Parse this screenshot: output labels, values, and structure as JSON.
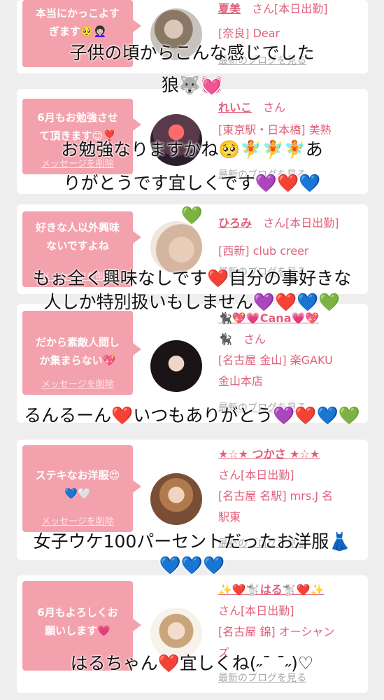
{
  "colors": {
    "pink": "#f3a2ad",
    "name": "#e0607a",
    "bg": "#eeeeee"
  },
  "cards": [
    {
      "message": "本当にかっこよす\nぎます🥺👩🏻‍🦱",
      "delete": "メッセージを削除",
      "name": "夏美",
      "san": "さん",
      "status": "[本日出勤]",
      "area": "[奈良] Dear",
      "blog": "最新のブログを見る"
    },
    {
      "message": "6月もお勉強させ\nて頂きます😊❣️",
      "delete": "メッセージを削除",
      "name": "れいこ",
      "san": "さん",
      "status": "",
      "area": "[東京駅・日本橋] 美熟",
      "blog": "最新のブログを見る"
    },
    {
      "message": "好きな人以外興味\nないですよね",
      "delete": "メッセージを削除",
      "name": "ひろみ",
      "san": "さん",
      "status": "[本日出勤]",
      "area": "[西新] club creer",
      "blog": "最新のブログを見る"
    },
    {
      "message": "だから素敵人間し\nか集まらない💖",
      "delete": "メッセージを削除",
      "name": "🐈‍⬛💖💗Cana💗💖",
      "name2": "🐈‍⬛",
      "san": "さん",
      "status": "",
      "area": "[名古屋 金山] 楽GAKU\n金山本店",
      "blog": "最新のブログを見る"
    },
    {
      "message": "ステキなお洋服😍\n💙🤍",
      "delete": "メッセージを削除",
      "name": "★☆★ つかさ ★☆★",
      "san": "さん",
      "status": "[本日出勤]",
      "area": "[名古屋 名駅] mrs.J 名\n駅東",
      "blog": "最新のブログを見る"
    },
    {
      "message": "6月もよろしくお\n願いします💗",
      "delete": "メッセージを削除",
      "name": "✨❤️🐩はる🐩❤️✨",
      "san": "さん",
      "status": "[本日出勤]",
      "area": "[名古屋 錦] オーシャン\nズ",
      "blog": "最新のブログを見る"
    }
  ],
  "overlays": [
    {
      "text": "子供の頃からこんな感じでした"
    },
    {
      "text": "狼🐺💓"
    },
    {
      "text": "お勉強なりますかね🥺🧚🧚🧚あ"
    },
    {
      "text": "りがとうです宜しくです💜❤️💙"
    },
    {
      "text": "💚"
    },
    {
      "text": "もぉ全く興味なしです❤️自分の事好きな"
    },
    {
      "text": "人しか特別扱いもしません💜❤️💙💚"
    },
    {
      "text": "るんるーん❤️いつもありがとう💜❤️💙💚"
    },
    {
      "text": "女子ウケ100パーセントだったお洋服👗"
    },
    {
      "text": "💙💙💙"
    },
    {
      "text": "はるちゃん❤️宜しくね(˶¯ ¯˶)♡"
    }
  ]
}
